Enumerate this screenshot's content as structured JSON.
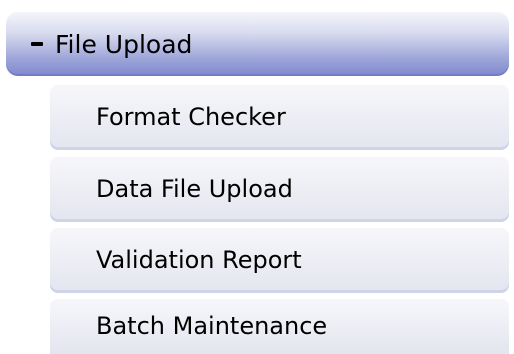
{
  "menu": {
    "header": {
      "toggle_icon": "minus-icon",
      "label": "File Upload"
    },
    "items": [
      {
        "label": "Format Checker"
      },
      {
        "label": "Data File Upload"
      },
      {
        "label": "Validation Report"
      },
      {
        "label": "Batch Maintenance"
      }
    ]
  },
  "colors": {
    "header_gradient_top": "#f4f5fb",
    "header_gradient_bottom": "#7f88cf",
    "item_background": "#eeeff5",
    "item_border": "#d0d4ea",
    "text": "#000000"
  }
}
